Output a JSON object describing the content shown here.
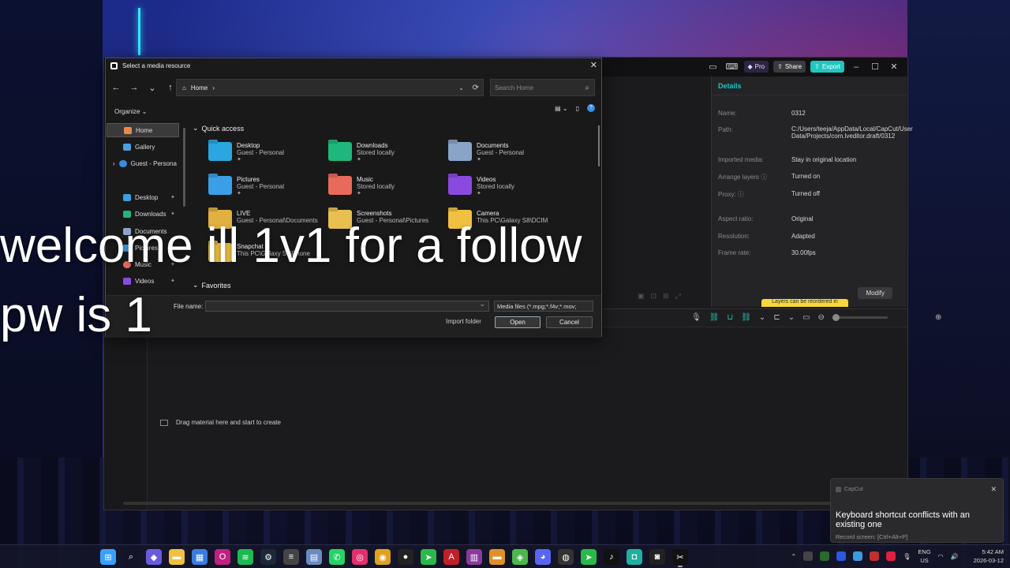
{
  "overlay": {
    "line1": "welcome ill 1v1 for a follow",
    "line2": "pw is 1"
  },
  "capcut": {
    "title_buttons": {
      "pro": "Pro",
      "share": "Share",
      "export": "Export"
    },
    "details": {
      "header": "Details",
      "rows": [
        {
          "label": "Name:",
          "value": "0312"
        },
        {
          "label": "Path:",
          "value": "C:/Users/teeja/AppData/Local/CapCut/User Data/Projects/com.lveditor.draft/0312"
        },
        {
          "label": "Imported media:",
          "value": "Stay in original location"
        },
        {
          "label": "Arrange layers",
          "value": "Turned on"
        },
        {
          "label": "Proxy:",
          "value": "Turned off"
        },
        {
          "label": "Aspect ratio:",
          "value": "Original"
        },
        {
          "label": "Resolution:",
          "value": "Adapted"
        },
        {
          "label": "Frame rate:",
          "value": "30.00fps"
        }
      ],
      "modify": "Modify",
      "tip": "Layers can be reordered in"
    },
    "drag_hint": "Drag material here and start to create"
  },
  "dialog": {
    "title": "Select a media resource",
    "address": "Home",
    "search_placeholder": "Search Home",
    "organize": "Organize",
    "nav": {
      "home": "Home",
      "gallery": "Gallery",
      "guest": "Guest - Persona",
      "desktop": "Desktop",
      "downloads": "Downloads",
      "documents": "Documents",
      "pictures": "Pictures",
      "music": "Music",
      "videos": "Videos"
    },
    "quick_access_label": "Quick access",
    "favorites_label": "Favorites",
    "quick_access": [
      {
        "name": "Desktop",
        "sub": "Guest - Personal",
        "color": "#2aa6e0"
      },
      {
        "name": "Downloads",
        "sub": "Stored locally",
        "color": "#1fb87a"
      },
      {
        "name": "Documents",
        "sub": "Guest - Personal",
        "color": "#8aa4c8"
      },
      {
        "name": "Pictures",
        "sub": "Guest - Personal",
        "color": "#3b9fe8"
      },
      {
        "name": "Music",
        "sub": "Stored locally",
        "color": "#e86a5a"
      },
      {
        "name": "Videos",
        "sub": "Stored locally",
        "color": "#8a4ae0"
      },
      {
        "name": "LIVE",
        "sub": "Guest - Personal\\Documents",
        "color": "#e0b040"
      },
      {
        "name": "Screenshots",
        "sub": "Guest - Personal\\Pictures",
        "color": "#e8c050"
      },
      {
        "name": "Camera",
        "sub": "This PC\\Galaxy S8\\DCIM",
        "color": "#f0c040"
      },
      {
        "name": "Snapchat",
        "sub": "This PC\\Galaxy S8\\Phone",
        "color": "#f0c040"
      }
    ],
    "file_name_label": "File name:",
    "file_name_value": "",
    "filter": "Media files (*.mpg;*.f4v;*.mov;",
    "import_folder": "Import folder",
    "open": "Open",
    "cancel": "Cancel"
  },
  "toast": {
    "app": "CapCut",
    "message": "Keyboard shortcut conflicts with an existing one",
    "sub": "Record screen: [Ctrl+Alt+P]"
  },
  "taskbar": {
    "lang_top": "ENG",
    "lang_bottom": "US",
    "time": "5:42 AM",
    "date": "2026-03-12",
    "apps": [
      {
        "icon": "windows-start-icon",
        "glyph": "⊞",
        "color": "#3aa0ff"
      },
      {
        "icon": "search-icon",
        "glyph": "⌕",
        "color": "transparent"
      },
      {
        "icon": "copilot-icon",
        "glyph": "◆",
        "color": "#6a5ae0"
      },
      {
        "icon": "file-explorer-icon",
        "glyph": "▬",
        "color": "#f0c040"
      },
      {
        "icon": "store-icon",
        "glyph": "▦",
        "color": "#3a7be0"
      },
      {
        "icon": "opera-icon",
        "glyph": "O",
        "color": "#c02080"
      },
      {
        "icon": "spotify-icon",
        "glyph": "≋",
        "color": "#1db954"
      },
      {
        "icon": "steam-icon",
        "glyph": "⚙",
        "color": "#1b2838"
      },
      {
        "icon": "app-icon",
        "glyph": "≡",
        "color": "#444"
      },
      {
        "icon": "notepad-icon",
        "glyph": "▤",
        "color": "#6a8ac0"
      },
      {
        "icon": "whatsapp-icon",
        "glyph": "✆",
        "color": "#25d366"
      },
      {
        "icon": "instagram-icon",
        "glyph": "◎",
        "color": "#e1306c"
      },
      {
        "icon": "chrome-icon",
        "glyph": "◉",
        "color": "#e0a020"
      },
      {
        "icon": "obs-icon",
        "glyph": "●",
        "color": "#222"
      },
      {
        "icon": "app-green-icon",
        "glyph": "➤",
        "color": "#2ab84a"
      },
      {
        "icon": "acrobat-icon",
        "glyph": "A",
        "color": "#c0202a"
      },
      {
        "icon": "winrar-icon",
        "glyph": "▥",
        "color": "#8a3a9a"
      },
      {
        "icon": "folder-icon",
        "glyph": "▬",
        "color": "#e0902a"
      },
      {
        "icon": "bluestacks-icon",
        "glyph": "◈",
        "color": "#4ab84a"
      },
      {
        "icon": "discord-icon",
        "glyph": "◕",
        "color": "#5865f2"
      },
      {
        "icon": "obs-studio-icon",
        "glyph": "◍",
        "color": "#333"
      },
      {
        "icon": "app-green2-icon",
        "glyph": "➤",
        "color": "#2ab84a"
      },
      {
        "icon": "tiktok-icon",
        "glyph": "♪",
        "color": "#111"
      },
      {
        "icon": "app-teal-icon",
        "glyph": "◘",
        "color": "#1fb0a0"
      },
      {
        "icon": "app-dark-icon",
        "glyph": "◙",
        "color": "#222"
      },
      {
        "icon": "capcut-icon",
        "glyph": "✂",
        "color": "#111"
      }
    ]
  }
}
